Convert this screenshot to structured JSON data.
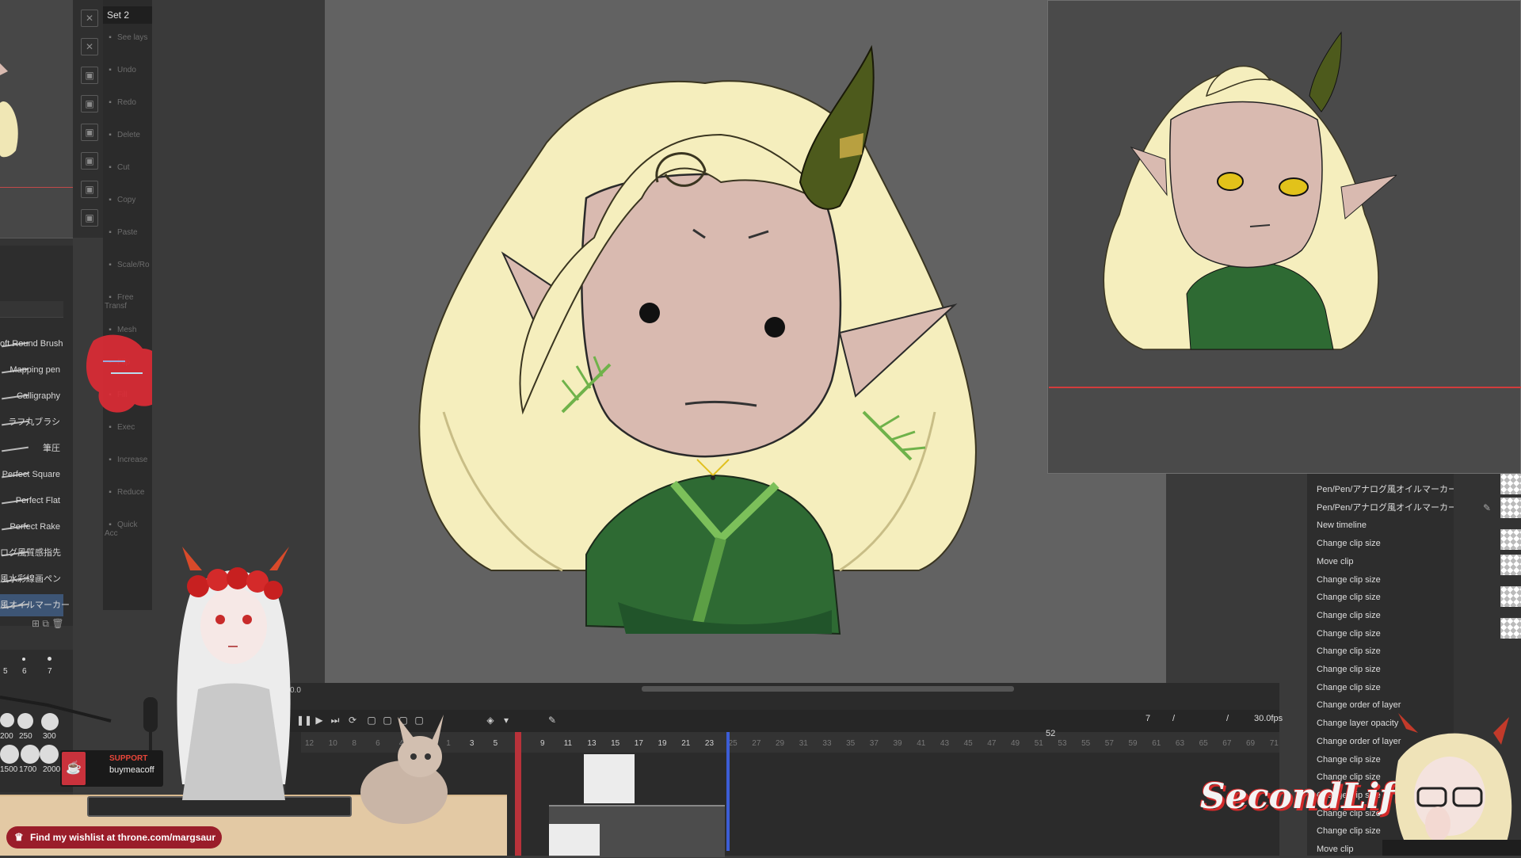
{
  "command_bar": {
    "set_label": "Set 2",
    "commands": [
      {
        "label": "See lays",
        "icon": "eye-icon"
      },
      {
        "label": "Undo",
        "icon": "undo-icon"
      },
      {
        "label": "Redo",
        "icon": "redo-icon"
      },
      {
        "label": "Delete",
        "icon": "delete-icon"
      },
      {
        "label": "Cut",
        "icon": "cut-icon"
      },
      {
        "label": "Copy",
        "icon": "copy-icon"
      },
      {
        "label": "Paste",
        "icon": "paste-icon"
      },
      {
        "label": "Scale/Ro",
        "icon": "scale-icon"
      },
      {
        "label": "Free Transf",
        "icon": "transform-icon"
      },
      {
        "label": "Mesh",
        "icon": "mesh-icon"
      },
      {
        "label": "Flip",
        "icon": "flip-icon"
      },
      {
        "label": "Fill",
        "icon": "fill-icon"
      },
      {
        "label": "Exec",
        "icon": "exec-icon"
      },
      {
        "label": "Increase",
        "icon": "increase-icon"
      },
      {
        "label": "Reduce",
        "icon": "reduce-icon"
      },
      {
        "label": "Quick Acc",
        "icon": "quick-icon"
      }
    ]
  },
  "brushes": [
    {
      "label": "oft Round Brush"
    },
    {
      "label": "Mapping pen"
    },
    {
      "label": "Calligraphy"
    },
    {
      "label": "ラフ丸ブラシ"
    },
    {
      "label": "筆圧"
    },
    {
      "label": "Perfect Square"
    },
    {
      "label": "Perfect Flat"
    },
    {
      "label": "Perfect Rake"
    },
    {
      "label": "ログ風質感指先"
    },
    {
      "label": "風水彩線画ペン"
    },
    {
      "label": "風オイルマーカー"
    }
  ],
  "brush_sizes": {
    "row1": [
      "5",
      "6",
      "7"
    ],
    "row2": [
      "200",
      "250",
      "300"
    ],
    "row3": [
      "1500",
      "1700",
      "2000"
    ]
  },
  "history": [
    "Pen/Pen/アナログ風オイルマーカー",
    "Pen/Pen/アナログ風オイルマーカー",
    "New timeline",
    "Change clip size",
    "Move clip",
    "Change clip size",
    "Change clip size",
    "Change clip size",
    "Change clip size",
    "Change clip size",
    "Change clip size",
    "Change clip size",
    "Change order of layer",
    "Change layer opacity",
    "Change order of layer",
    "Change clip size",
    "Change clip size",
    "Change clip size",
    "Change clip size",
    "Change clip size",
    "Move clip"
  ],
  "timeline": {
    "time_readout": "0.0",
    "current_frame": "7",
    "fps": "30.0fps",
    "marker": "52",
    "ticks": [
      "12",
      "10",
      "8",
      "6",
      "4",
      "2",
      "1",
      "3",
      "5",
      "7",
      "9",
      "11",
      "13",
      "15",
      "17",
      "19",
      "21",
      "23",
      "25",
      "27",
      "29",
      "31",
      "33",
      "35",
      "37",
      "39",
      "41",
      "43",
      "45",
      "47",
      "49",
      "51",
      "53",
      "55",
      "57",
      "59",
      "61",
      "63",
      "65",
      "67",
      "69",
      "71"
    ]
  },
  "overlay": {
    "wishlist": "Find my wishlist at throne.com/margsaur",
    "support_title": "SUPPORT",
    "support_sub": "buymeacoff",
    "logo": "SecondLife"
  },
  "colors": {
    "hair": "#f5eebd",
    "skin": "#d9bab0",
    "robe": "#2e6a33",
    "horn": "#4d5a1c",
    "accent_red": "#c9323c"
  }
}
